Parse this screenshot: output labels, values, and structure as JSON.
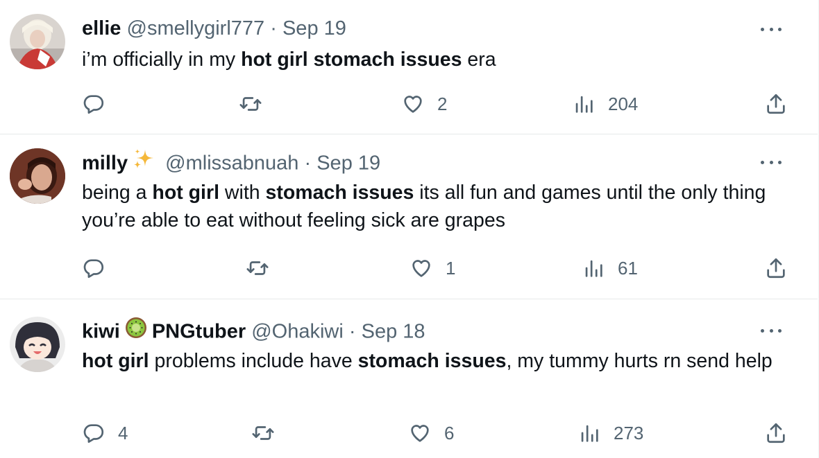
{
  "tweets": [
    {
      "name": "ellie",
      "handle": "@smellygirl777",
      "sep": "·",
      "date": "Sep 19",
      "text": [
        {
          "t": "i’m officially in my ",
          "b": false
        },
        {
          "t": "hot girl stomach issues",
          "b": true
        },
        {
          "t": " era",
          "b": false
        }
      ],
      "replies": "",
      "retweets": "",
      "likes": "2",
      "views": "204"
    },
    {
      "name": "milly",
      "badge": "sparkles-emoji",
      "handle": "@mlissabnuah",
      "sep": "·",
      "date": "Sep 19",
      "text": [
        {
          "t": "being a ",
          "b": false
        },
        {
          "t": "hot girl",
          "b": true
        },
        {
          "t": " with ",
          "b": false
        },
        {
          "t": "stomach issues",
          "b": true
        },
        {
          "t": " its all fun and games until the only thing you’re able to eat without feeling sick are grapes",
          "b": false
        }
      ],
      "replies": "",
      "retweets": "",
      "likes": "1",
      "views": "61"
    },
    {
      "name": "kiwi",
      "badge": "kiwi-emoji",
      "name_suffix": "PNGtuber",
      "handle": "@Ohakiwi",
      "sep": "·",
      "date": "Sep 18",
      "text": [
        {
          "t": "hot girl",
          "b": true
        },
        {
          "t": " problems include have ",
          "b": false
        },
        {
          "t": "stomach issues",
          "b": true
        },
        {
          "t": ", my tummy hurts rn send help",
          "b": false
        }
      ],
      "replies": "4",
      "retweets": "",
      "likes": "6",
      "views": "273"
    }
  ],
  "colors": {
    "text": "#0f1419",
    "secondary": "#536471",
    "divider": "#e6e9ea"
  },
  "icons": [
    "reply-icon",
    "retweet-icon",
    "like-icon",
    "views-icon",
    "share-icon",
    "more-icon"
  ]
}
